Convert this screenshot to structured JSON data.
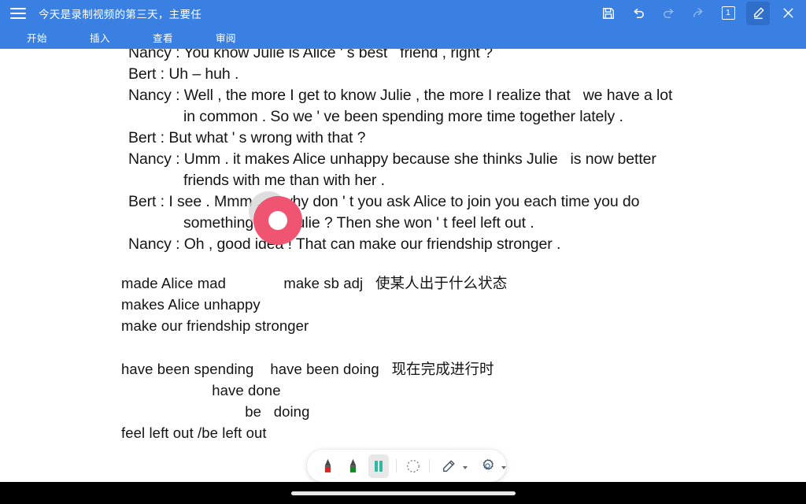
{
  "header": {
    "menu_icon": "hamburger-icon",
    "doc_title": "今天是录制视频的第三天，主要任",
    "tools": [
      {
        "name": "save-icon",
        "label": "保存",
        "state": "enabled"
      },
      {
        "name": "undo-icon",
        "label": "撤销",
        "state": "enabled"
      },
      {
        "name": "redo-icon",
        "label": "重做",
        "state": "disabled"
      },
      {
        "name": "share-icon",
        "label": "分享",
        "state": "disabled"
      },
      {
        "name": "page-count-badge",
        "label": "1",
        "state": "enabled"
      },
      {
        "name": "pen-icon",
        "label": "批注",
        "state": "active"
      },
      {
        "name": "close-icon",
        "label": "关闭",
        "state": "enabled"
      }
    ],
    "page_number": "1",
    "tabs": [
      {
        "label": "开始"
      },
      {
        "label": "插入"
      },
      {
        "label": "查看"
      },
      {
        "label": "审阅"
      }
    ]
  },
  "document": {
    "dialogue": [
      {
        "text": "Nancy : You know Julie is Alice ' s best   friend , right ?",
        "indent": false
      },
      {
        "text": "Bert : Uh – huh .",
        "indent": false
      },
      {
        "text": "Nancy : Well , the more I get to know Julie , the more I realize that   we have a lot",
        "indent": false
      },
      {
        "text": "in common . So we ' ve been spending more time together lately .",
        "indent": true
      },
      {
        "text": "Bert : But what ' s wrong with that ?",
        "indent": false
      },
      {
        "text": "Nancy : Umm . it makes Alice unhappy because she thinks Julie   is now better",
        "indent": false
      },
      {
        "text": "friends with me than with her .",
        "indent": true
      },
      {
        "text": "Bert : I see . Mmm . . . why don ' t you ask Alice to join you each time you do",
        "indent": false
      },
      {
        "text": "something with Julie ? Then she won ' t feel left out .",
        "indent": true
      },
      {
        "text": "Nancy : Oh , good idea ! That can make our friendship stronger .",
        "indent": false
      }
    ],
    "vocab_notes": [
      "made Alice mad              make sb adj   使某人出于什么状态",
      "makes Alice unhappy",
      "make our friendship stronger"
    ],
    "grammar_notes": [
      "have been spending    have been doing   现在完成进行时",
      "                      have done",
      "                              be   doing",
      "feel left out /be left out"
    ]
  },
  "tap_indicator": {
    "name": "tap-gesture-indicator",
    "color": "#ef5571",
    "ghost_color": "#d8d8d8"
  },
  "float_toolbar": {
    "items": [
      {
        "name": "red-marker-icon",
        "label": "红色马克笔",
        "selected": false,
        "color": "#d9241f"
      },
      {
        "name": "green-marker-icon",
        "label": "绿色马克笔",
        "selected": false,
        "color": "#0a8a1f"
      },
      {
        "name": "pause-recording-icon",
        "label": "暂停录制",
        "selected": true,
        "color": "#2eb9a0"
      },
      {
        "name": "eraser-icon",
        "label": "橡皮擦",
        "selected": false,
        "color": "#777777"
      },
      {
        "name": "pen-tool-icon",
        "label": "画笔",
        "selected": false,
        "color": "#4a5a6a",
        "has_dropdown": true
      },
      {
        "name": "settings-gear-icon",
        "label": "设置",
        "selected": false,
        "color": "#3f4a55",
        "has_dropdown": true
      }
    ]
  },
  "navbar": {
    "home_indicator": "home-indicator-pill"
  },
  "colors": {
    "header_blue": "#3a80e2",
    "header_active": "#2f6fc9",
    "page_bg": "#ffffff",
    "text": "#151515",
    "navbar_bg": "#000000"
  }
}
